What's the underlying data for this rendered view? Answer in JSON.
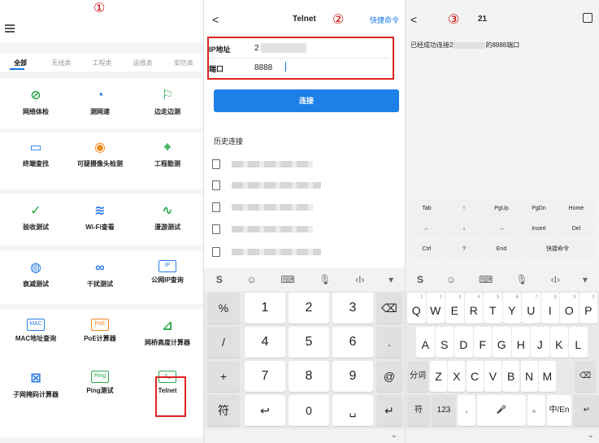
{
  "steps": {
    "p1": "①",
    "p2": "②",
    "p3": "③"
  },
  "toolbox": {
    "tabs": [
      "全部",
      "无线类",
      "工程类",
      "运维类",
      "安防类"
    ],
    "tools": [
      {
        "label": "网络体检",
        "icon": "shield-check-icon",
        "glyph": "⊘",
        "color": "#2aa84a"
      },
      {
        "label": "测网速",
        "icon": "speed-gauge-icon",
        "glyph": "◔",
        "color": "#2a7de1"
      },
      {
        "label": "边走边测",
        "icon": "walking-person-icon",
        "glyph": "⚐",
        "color": "#2aa84a"
      },
      {
        "label": "终端查找",
        "icon": "terminal-search-icon",
        "glyph": "▭",
        "color": "#2a7de1"
      },
      {
        "label": "可疑摄像头检测",
        "icon": "camera-icon",
        "glyph": "◉",
        "color": "#f08a24"
      },
      {
        "label": "工程勘测",
        "icon": "location-survey-icon",
        "glyph": "⌖",
        "color": "#2aa84a"
      },
      {
        "label": "验收测试",
        "icon": "check-circle-icon",
        "glyph": "✓",
        "color": "#2aa84a"
      },
      {
        "label": "Wi-Fi查看",
        "icon": "wifi-icon",
        "glyph": "≋",
        "color": "#2a7de1"
      },
      {
        "label": "漫游测试",
        "icon": "roaming-icon",
        "glyph": "∿",
        "color": "#2aa84a"
      },
      {
        "label": "衰减测试",
        "icon": "attenuation-icon",
        "glyph": "◍",
        "color": "#2a7de1"
      },
      {
        "label": "干扰测试",
        "icon": "interference-icon",
        "glyph": "∞",
        "color": "#2a7de1"
      },
      {
        "label": "公网IP查询",
        "icon": "ip-icon",
        "glyph": "IP",
        "color": "#2a7de1"
      },
      {
        "label": "MAC地址查询",
        "icon": "mac-icon",
        "glyph": "MAC",
        "color": "#2a7de1"
      },
      {
        "label": "PoE计算器",
        "icon": "poe-icon",
        "glyph": "PoE",
        "color": "#f08a24"
      },
      {
        "label": "网桥高度计算器",
        "icon": "bridge-height-icon",
        "glyph": "⊿",
        "color": "#2aa84a"
      },
      {
        "label": "子网掩码计算器",
        "icon": "subnet-icon",
        "glyph": "⊠",
        "color": "#2a7de1"
      },
      {
        "label": "Ping测试",
        "icon": "ping-icon",
        "glyph": "Ping",
        "color": "#2aa84a"
      },
      {
        "label": "Telnet",
        "icon": "telnet-terminal-icon",
        "glyph": ">_",
        "color": "#2aa84a"
      }
    ]
  },
  "telnet_form": {
    "back": "<",
    "title": "Telnet",
    "quick_cmd": "快捷命令",
    "ip_label": "IP地址",
    "ip_value": "2",
    "port_label": "端口",
    "port_value": "8888",
    "connect": "连接",
    "history_title": "历史连接"
  },
  "keyboard_num": {
    "left": [
      "%",
      "/",
      "+",
      "符"
    ],
    "keys": [
      [
        "1",
        "2",
        "3"
      ],
      [
        "4",
        "5",
        "6"
      ],
      [
        "7",
        "8",
        "9"
      ]
    ],
    "right": [
      "⌫",
      ".",
      "@",
      "↵"
    ],
    "bottom": [
      "↩",
      "0",
      "␣"
    ]
  },
  "session": {
    "back": "<",
    "title": "21",
    "message_prefix": "已经成功连接2",
    "message_suffix": "的8888端口",
    "func_keys": [
      [
        "Tab",
        "↑",
        "PgUp",
        "PgDn",
        "Home"
      ],
      [
        "←",
        "↓",
        "→",
        "Insert",
        "Del"
      ],
      [
        "Ctrl",
        "?",
        "End",
        "快捷命令"
      ]
    ]
  },
  "keyboard_qwerty": {
    "row1": [
      "Q",
      "W",
      "E",
      "R",
      "T",
      "Y",
      "U",
      "I",
      "O",
      "P"
    ],
    "row1_sub": [
      "1",
      "2",
      "3",
      "4",
      "5",
      "6",
      "7",
      "8",
      "9",
      "0"
    ],
    "row2": [
      "A",
      "S",
      "D",
      "F",
      "G",
      "H",
      "J",
      "K",
      "L"
    ],
    "row3": [
      "分词",
      "Z",
      "X",
      "C",
      "V",
      "B",
      "N",
      "M",
      "⌫"
    ],
    "row4": [
      "符",
      "123",
      ",",
      "🎤",
      "。",
      "中/En",
      "↵"
    ]
  }
}
